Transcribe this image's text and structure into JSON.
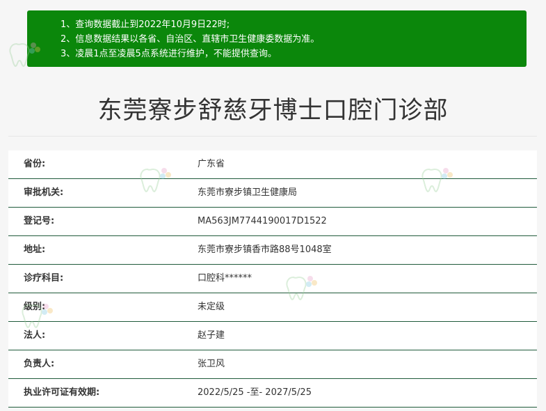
{
  "notice": {
    "lines": [
      "1、查询数据截止到2022年10月9日22时;",
      "2、信息数据结果以各省、自治区、直辖市卫生健康委数据为准。",
      "3、凌晨1点至凌晨5点系统进行维护，不能提供查询。"
    ]
  },
  "title": "东莞寮步舒慈牙博士口腔门诊部",
  "rows": [
    {
      "label": "省份:",
      "value": "广东省"
    },
    {
      "label": "审批机关:",
      "value": "东莞市寮步镇卫生健康局"
    },
    {
      "label": "登记号:",
      "value": "MA563JM7744190017D1522"
    },
    {
      "label": "地址:",
      "value": "东莞市寮步镇香市路88号1048室"
    },
    {
      "label": "诊疗科目:",
      "value": "口腔科******"
    },
    {
      "label": "级别:",
      "value": "未定级"
    },
    {
      "label": "法人:",
      "value": "赵子建"
    },
    {
      "label": "负责人:",
      "value": "张卫风"
    },
    {
      "label": "执业许可证有效期:",
      "value": "2022/5/25 -至- 2027/5/25"
    }
  ],
  "watermark": {
    "icon": "tooth-flower-logo-icon"
  }
}
